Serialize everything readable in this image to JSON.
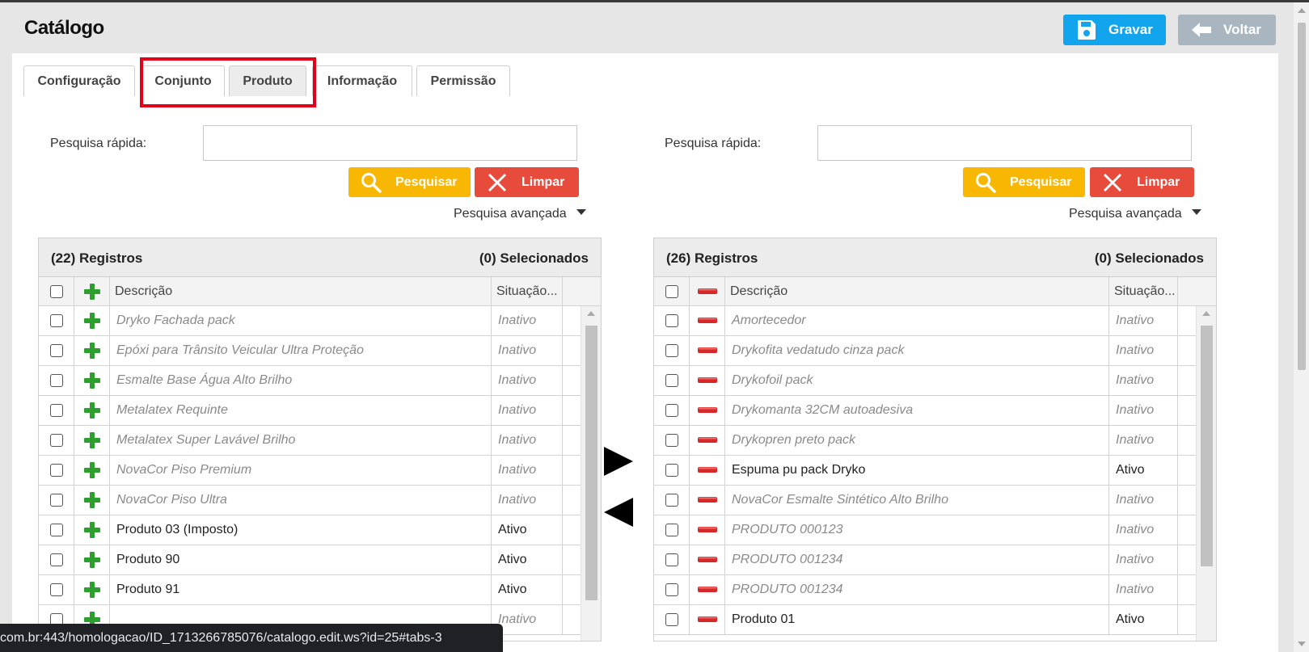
{
  "header": {
    "title": "Catálogo",
    "save_label": "Gravar",
    "back_label": "Voltar"
  },
  "tabs": [
    {
      "label": "Configuração"
    },
    {
      "label": "Conjunto"
    },
    {
      "label": "Produto"
    },
    {
      "label": "Informação"
    },
    {
      "label": "Permissão"
    }
  ],
  "left": {
    "search_label": "Pesquisa rápida:",
    "search_value": "",
    "search_button": "Pesquisar",
    "clear_button": "Limpar",
    "advanced_label": "Pesquisa avançada",
    "records": "(22) Registros",
    "selected": "(0) Selecionados",
    "col_desc": "Descrição",
    "col_status": "Situação...",
    "row_icon": "plus-icon",
    "rows": [
      {
        "desc": "Dryko Fachada pack",
        "status": "Inativo",
        "active": false
      },
      {
        "desc": "Epóxi para Trânsito Veicular Ultra Proteção",
        "status": "Inativo",
        "active": false
      },
      {
        "desc": "Esmalte Base Água Alto Brilho",
        "status": "Inativo",
        "active": false
      },
      {
        "desc": "Metalatex Requinte",
        "status": "Inativo",
        "active": false
      },
      {
        "desc": "Metalatex Super Lavável Brilho",
        "status": "Inativo",
        "active": false
      },
      {
        "desc": "NovaCor Piso Premium",
        "status": "Inativo",
        "active": false
      },
      {
        "desc": "NovaCor Piso Ultra",
        "status": "Inativo",
        "active": false
      },
      {
        "desc": "Produto 03 (Imposto)",
        "status": "Ativo",
        "active": true
      },
      {
        "desc": "Produto 90",
        "status": "Ativo",
        "active": true
      },
      {
        "desc": "Produto 91",
        "status": "Ativo",
        "active": true
      },
      {
        "desc": "",
        "status": "Inativo",
        "active": false
      }
    ]
  },
  "right": {
    "search_label": "Pesquisa rápida:",
    "search_value": "",
    "search_button": "Pesquisar",
    "clear_button": "Limpar",
    "advanced_label": "Pesquisa avançada",
    "records": "(26) Registros",
    "selected": "(0) Selecionados",
    "col_desc": "Descrição",
    "col_status": "Situação...",
    "row_icon": "minus-icon",
    "rows": [
      {
        "desc": "Amortecedor",
        "status": "Inativo",
        "active": false
      },
      {
        "desc": "Drykofita vedatudo cinza pack",
        "status": "Inativo",
        "active": false
      },
      {
        "desc": "Drykofoil pack",
        "status": "Inativo",
        "active": false
      },
      {
        "desc": "Drykomanta 32CM autoadesiva",
        "status": "Inativo",
        "active": false
      },
      {
        "desc": "Drykopren preto pack",
        "status": "Inativo",
        "active": false
      },
      {
        "desc": "Espuma pu pack Dryko",
        "status": "Ativo",
        "active": true
      },
      {
        "desc": "NovaCor Esmalte Sintético Alto Brilho",
        "status": "Inativo",
        "active": false
      },
      {
        "desc": "PRODUTO 000123",
        "status": "Inativo",
        "active": false
      },
      {
        "desc": "PRODUTO 001234",
        "status": "Inativo",
        "active": false
      },
      {
        "desc": "PRODUTO 001234",
        "status": "Inativo",
        "active": false
      },
      {
        "desc": "Produto 01",
        "status": "Ativo",
        "active": true
      }
    ]
  },
  "status_bar": {
    "url": "com.br:443/homologacao/ID_1713266785076/catalogo.edit.ws?id=25#tabs-3"
  },
  "colors": {
    "save": "#13a4ee",
    "back": "#a9b6c0",
    "search": "#f8b702",
    "clear": "#e64b3c",
    "highlight": "#e2001a",
    "plus": "#2e9e2e",
    "minus": "#d62828"
  }
}
